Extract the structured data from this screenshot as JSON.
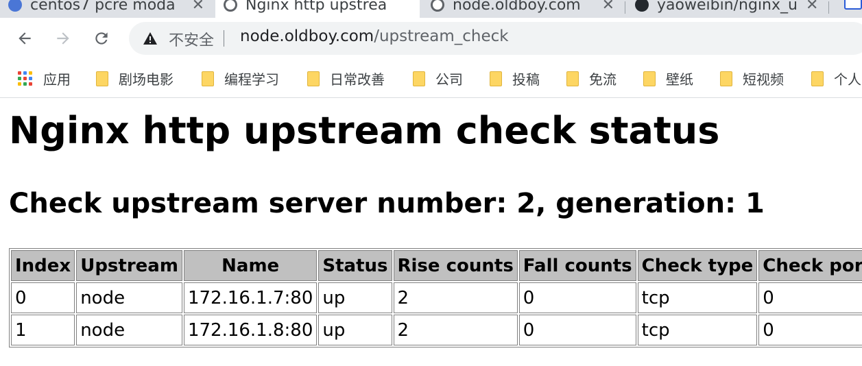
{
  "browser": {
    "tabs": [
      {
        "title": "centos7 pcre modä",
        "active": false
      },
      {
        "title": "Nginx http upstrea",
        "active": true
      },
      {
        "title": "node.oldboy.com",
        "active": false
      },
      {
        "title": "yaoweibin/nginx_u",
        "active": false
      }
    ],
    "address_bar": {
      "security_label": "不安全",
      "url_host": "node.oldboy.com",
      "url_path": "/upstream_check"
    },
    "bookmarks": [
      {
        "label": "应用",
        "icon": "apps-grid-icon"
      },
      {
        "label": "剧场电影",
        "icon": "folder-icon"
      },
      {
        "label": "编程学习",
        "icon": "folder-icon"
      },
      {
        "label": "日常改善",
        "icon": "folder-icon"
      },
      {
        "label": "公司",
        "icon": "folder-icon"
      },
      {
        "label": "投稿",
        "icon": "folder-icon"
      },
      {
        "label": "免流",
        "icon": "folder-icon"
      },
      {
        "label": "壁纸",
        "icon": "folder-icon"
      },
      {
        "label": "短视频",
        "icon": "folder-icon"
      },
      {
        "label": "个人",
        "icon": "folder-icon"
      }
    ]
  },
  "page": {
    "title": "Nginx http upstream check status",
    "subtitle": "Check upstream server number: 2, generation: 1",
    "table": {
      "headers": [
        "Index",
        "Upstream",
        "Name",
        "Status",
        "Rise counts",
        "Fall counts",
        "Check type",
        "Check port"
      ],
      "rows": [
        [
          "0",
          "node",
          "172.16.1.7:80",
          "up",
          "2",
          "0",
          "tcp",
          "0"
        ],
        [
          "1",
          "node",
          "172.16.1.8:80",
          "up",
          "2",
          "0",
          "tcp",
          "0"
        ]
      ]
    }
  },
  "colors": {
    "tabstrip_bg": "#dee1e6",
    "table_header_bg": "#c0c0c0",
    "folder_yellow": "#fdd663"
  }
}
